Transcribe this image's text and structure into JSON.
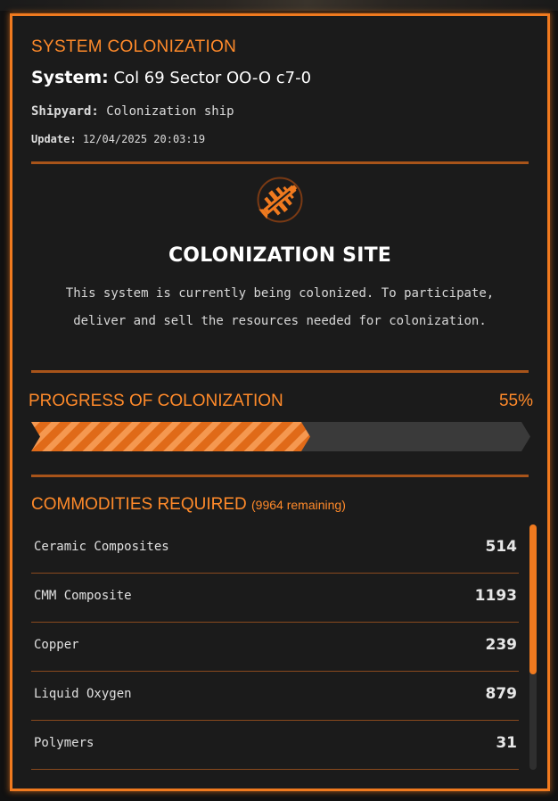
{
  "header": {
    "section_title": "SYSTEM COLONIZATION",
    "system_label": "System:",
    "system_name": "Col 69 Sector OO-O c7-0",
    "shipyard_label": "Shipyard:",
    "shipyard_value": "Colonization ship",
    "update_label": "Update:",
    "update_value": "12/04/2025 20:03:19"
  },
  "site": {
    "emblem_icon": "colonization-ship-emblem-icon",
    "title": "COLONIZATION SITE",
    "description": "This system is currently being colonized. To participate, deliver and sell the resources needed for colonization."
  },
  "progress": {
    "title": "PROGRESS OF COLONIZATION",
    "percent_label": "55%",
    "value": 0.55
  },
  "commodities": {
    "title": "COMMODITIES REQUIRED",
    "remaining": "(9964 remaining)",
    "items": [
      {
        "name": "Ceramic Composites",
        "qty": "514"
      },
      {
        "name": "CMM Composite",
        "qty": "1193"
      },
      {
        "name": "Copper",
        "qty": "239"
      },
      {
        "name": "Liquid Oxygen",
        "qty": "879"
      },
      {
        "name": "Polymers",
        "qty": "31"
      }
    ]
  },
  "scroll": {
    "visible_fraction": 0.61
  },
  "colors": {
    "accent": "#f07a1f",
    "accent_text": "#ff8a2a",
    "divider": "#a8541a",
    "panel_bg": "#1b1b1b"
  }
}
